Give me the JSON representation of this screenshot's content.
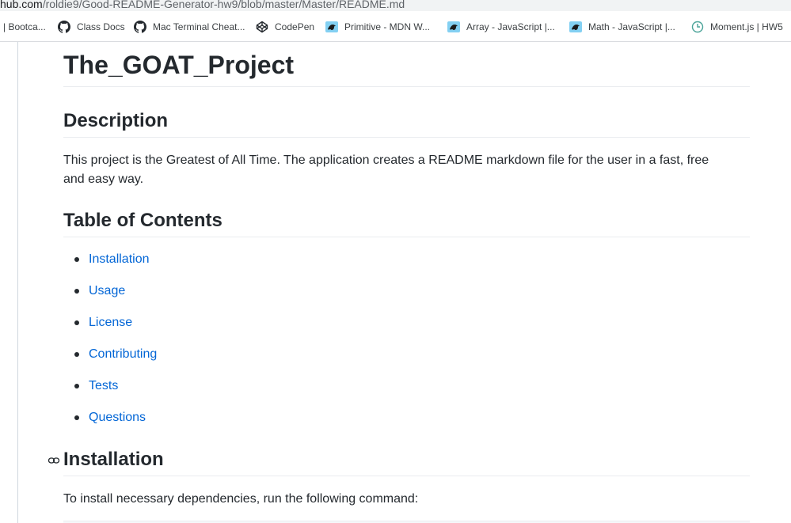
{
  "browser": {
    "url_host": "hub.com",
    "url_path": "/roldie9/Good-README-Generator-hw9/blob/master/Master/README.md",
    "bookmarks": [
      {
        "label": "| Bootca...",
        "icon": "none"
      },
      {
        "label": "Class Docs",
        "icon": "github-icon"
      },
      {
        "label": "Mac Terminal Cheat...",
        "icon": "github-icon"
      },
      {
        "label": "CodePen",
        "icon": "codepen-icon"
      },
      {
        "label": "Primitive - MDN W...",
        "icon": "mdn-icon"
      },
      {
        "label": "Array - JavaScript |...",
        "icon": "mdn-icon"
      },
      {
        "label": "Math - JavaScript |...",
        "icon": "mdn-icon"
      },
      {
        "label": "Moment.js | HW5",
        "icon": "clock-icon"
      }
    ]
  },
  "readme": {
    "title": "The_GOAT_Project",
    "description_heading": "Description",
    "description_text": "This project is the Greatest of All Time. The application creates a README markdown file for the user in a fast, free and easy way.",
    "toc_heading": "Table of Contents",
    "toc_items": [
      "Installation",
      "Usage",
      "License",
      "Contributing",
      "Tests",
      "Questions"
    ],
    "installation_heading": "Installation",
    "installation_text": "To install necessary dependencies, run the following command:"
  },
  "colors": {
    "link": "#0366d6",
    "text": "#24292e",
    "rule": "#eaecef",
    "mdn_icon_bg": "#83d0f2"
  }
}
